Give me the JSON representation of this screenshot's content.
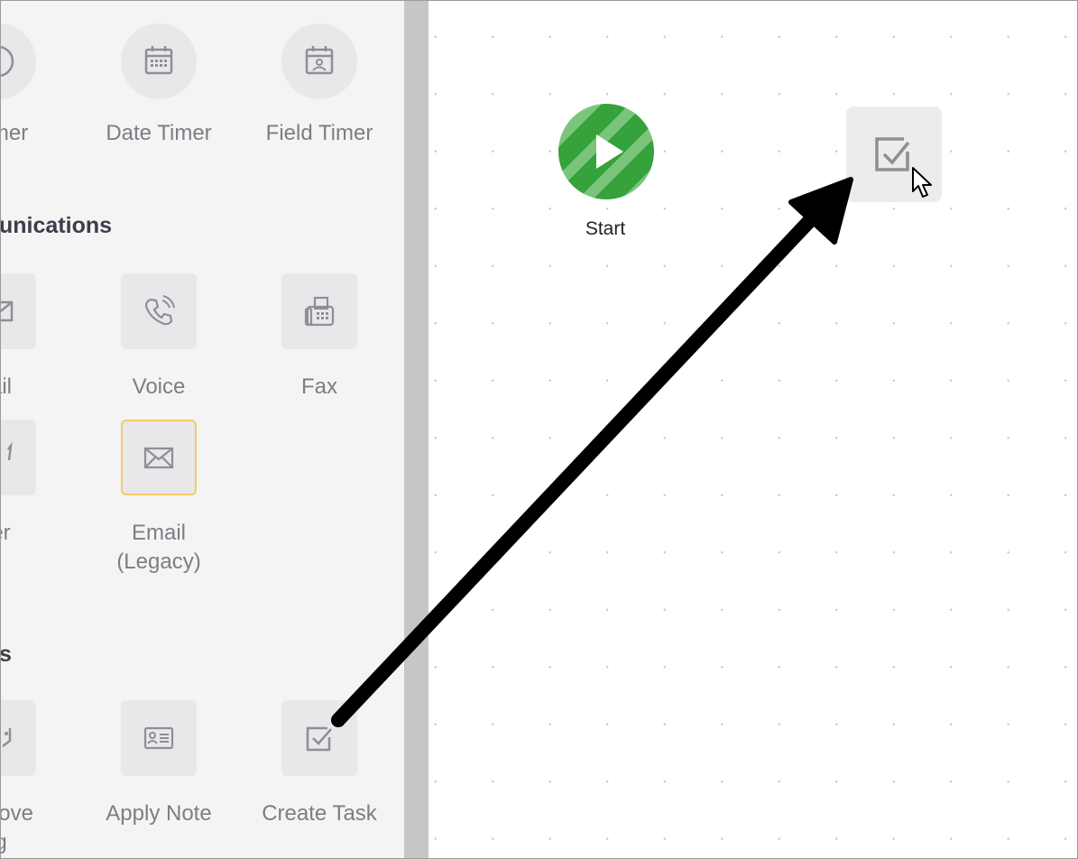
{
  "panel": {
    "timers": [
      {
        "label": "Timer",
        "icon": "clock-icon"
      },
      {
        "label": "Date Timer",
        "icon": "calendar-icon"
      },
      {
        "label": "Field Timer",
        "icon": "contact-calendar-icon"
      }
    ],
    "communications_heading": "unications",
    "communications": [
      {
        "label": "ail",
        "icon": "email-icon"
      },
      {
        "label": "Voice",
        "icon": "phone-icon"
      },
      {
        "label": "Fax",
        "icon": "fax-icon"
      },
      {
        "label": "er",
        "icon": "letter-icon"
      },
      {
        "label": "Email (Legacy)",
        "line1": "Email",
        "line2": "(Legacy)",
        "icon": "envelope-icon"
      }
    ],
    "actions_heading": "s",
    "actions": [
      {
        "label": "emove",
        "line2": "g",
        "icon": "tag-remove-icon"
      },
      {
        "label": "Apply Note",
        "icon": "note-icon"
      },
      {
        "label": "Create Task",
        "icon": "checkbox-icon"
      }
    ]
  },
  "canvas": {
    "start_label": "Start",
    "dropped_item": "Create Task",
    "colors": {
      "start_dark": "#36a23c",
      "start_light": "#7ac57b",
      "selection": "#f2cc6a"
    }
  }
}
